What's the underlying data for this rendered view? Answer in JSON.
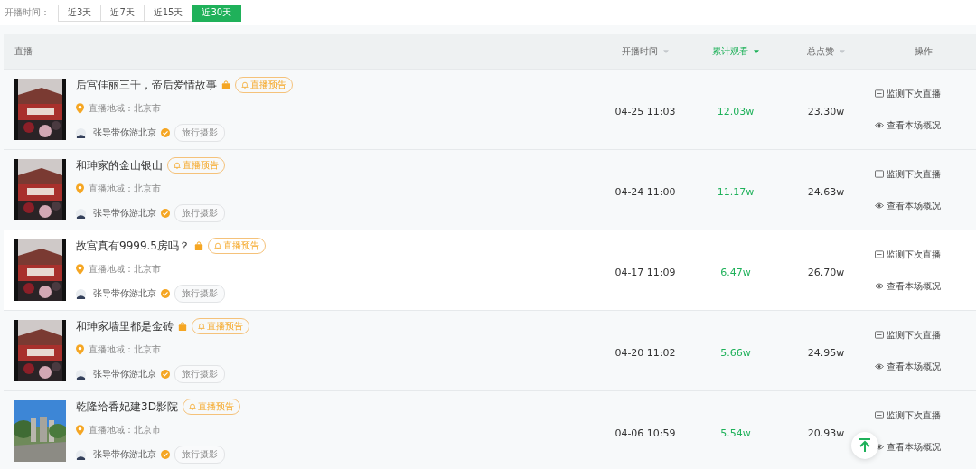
{
  "filter": {
    "label": "开播时间：",
    "options": [
      {
        "label": "近3天",
        "selected": false
      },
      {
        "label": "近7天",
        "selected": false
      },
      {
        "label": "近15天",
        "selected": false
      },
      {
        "label": "近30天",
        "selected": true
      }
    ]
  },
  "table": {
    "columns": [
      {
        "label": "直播",
        "kind": "plain",
        "selected": false
      },
      {
        "label": "开播时间",
        "kind": "sort",
        "selected": false
      },
      {
        "label": "累计观看",
        "kind": "sort",
        "selected": true
      },
      {
        "label": "总点赞",
        "kind": "sort",
        "selected": false
      },
      {
        "label": "操作",
        "kind": "plain",
        "selected": false
      }
    ],
    "rows": [
      {
        "title": "后宫佳丽三千，帝后爱情故事",
        "bag": true,
        "badge": "直播预告",
        "region": "直播地域：北京市",
        "author": "张导带你游北京",
        "tag": "旅行摄影",
        "time": "04-25 11:03",
        "views": "12.03w",
        "likes": "23.30w",
        "actions": [
          "监测下次直播",
          "查看本场概况"
        ]
      },
      {
        "title": "和珅家的金山银山",
        "bag": false,
        "badge": "直播预告",
        "region": "直播地域：北京市",
        "author": "张导带你游北京",
        "tag": "旅行摄影",
        "time": "04-24 11:00",
        "views": "11.17w",
        "likes": "24.63w",
        "actions": [
          "监测下次直播",
          "查看本场概况"
        ]
      },
      {
        "title": "故宫真有9999.5房吗？",
        "bag": true,
        "badge": "直播预告",
        "region": "直播地域：北京市",
        "author": "张导带你游北京",
        "tag": "旅行摄影",
        "time": "04-17 11:09",
        "views": "6.47w",
        "likes": "26.70w",
        "actions": [
          "监测下次直播",
          "查看本场概况"
        ]
      },
      {
        "title": "和珅家墙里都是金砖",
        "bag": true,
        "badge": "直播预告",
        "region": "直播地域：北京市",
        "author": "张导带你游北京",
        "tag": "旅行摄影",
        "time": "04-20 11:02",
        "views": "5.66w",
        "likes": "24.95w",
        "actions": [
          "监测下次直播",
          "查看本场概况"
        ]
      },
      {
        "title": "乾隆给香妃建3D影院",
        "bag": false,
        "badge": "直播预告",
        "region": "直播地域：北京市",
        "author": "张导带你游北京",
        "tag": "旅行摄影",
        "time": "04-06 10:59",
        "views": "5.54w",
        "likes": "20.93w",
        "actions": [
          "监测下次直播",
          "查看本场概况"
        ]
      }
    ]
  }
}
